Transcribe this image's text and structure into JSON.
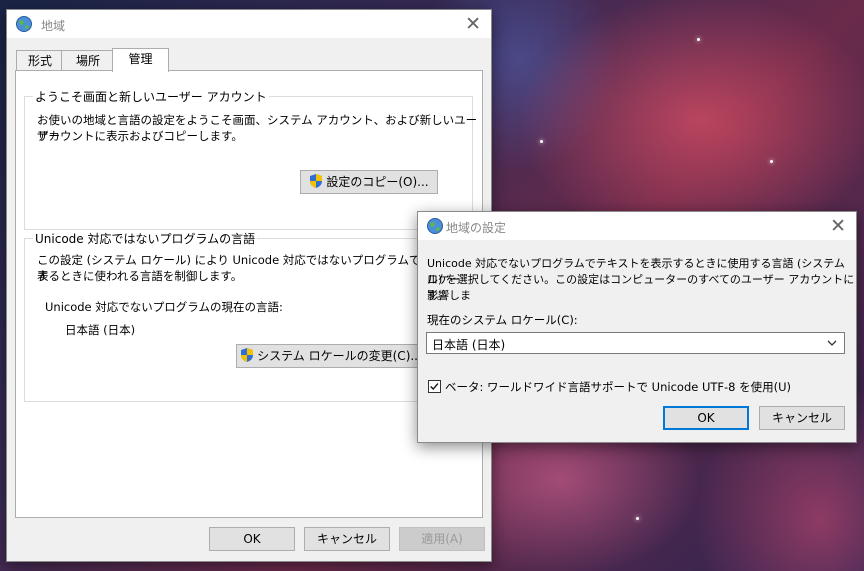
{
  "main_window": {
    "title": "地域",
    "tabs": [
      "形式",
      "場所",
      "管理"
    ],
    "active_tab": "管理",
    "group1": {
      "title": "ようこそ画面と新しいユーザー アカウント",
      "desc_line1": "お使いの地域と言語の設定をようこそ画面、システム アカウント、および新しいユーザー",
      "desc_line2": "アカウントに表示およびコピーします。",
      "copy_button": "設定のコピー(O)..."
    },
    "group2": {
      "title": "Unicode 対応ではないプログラムの言語",
      "desc_line1": "この設定 (システム ロケール) により Unicode 対応ではないプログラムでテキストを表",
      "desc_line2": "するときに使われる言語を制御します。",
      "current_label": "Unicode 対応でないプログラムの現在の言語:",
      "current_value": "日本語 (日本)",
      "change_button": "システム ロケールの変更(C)..."
    },
    "buttons": {
      "ok": "OK",
      "cancel": "キャンセル",
      "apply": "適用(A)"
    }
  },
  "dialog": {
    "title": "地域の設定",
    "desc_line1": "Unicode 対応でないプログラムでテキストを表示するときに使用する言語 (システム ロケー",
    "desc_line2": "ル) を選択してください。この設定はコンピューターのすべてのユーザー アカウントに影響しま",
    "desc_line3": "す。",
    "locale_label": "現在のシステム ロケール(C):",
    "locale_value": "日本語 (日本)",
    "beta_checkbox_label": "ベータ: ワールドワイド言語サポートで Unicode UTF-8 を使用(U)",
    "beta_checked": true,
    "buttons": {
      "ok": "OK",
      "cancel": "キャンセル"
    }
  },
  "icons": [
    "globe-icon",
    "close-icon",
    "shield-icon",
    "chevron-down-icon",
    "checkmark-icon"
  ]
}
